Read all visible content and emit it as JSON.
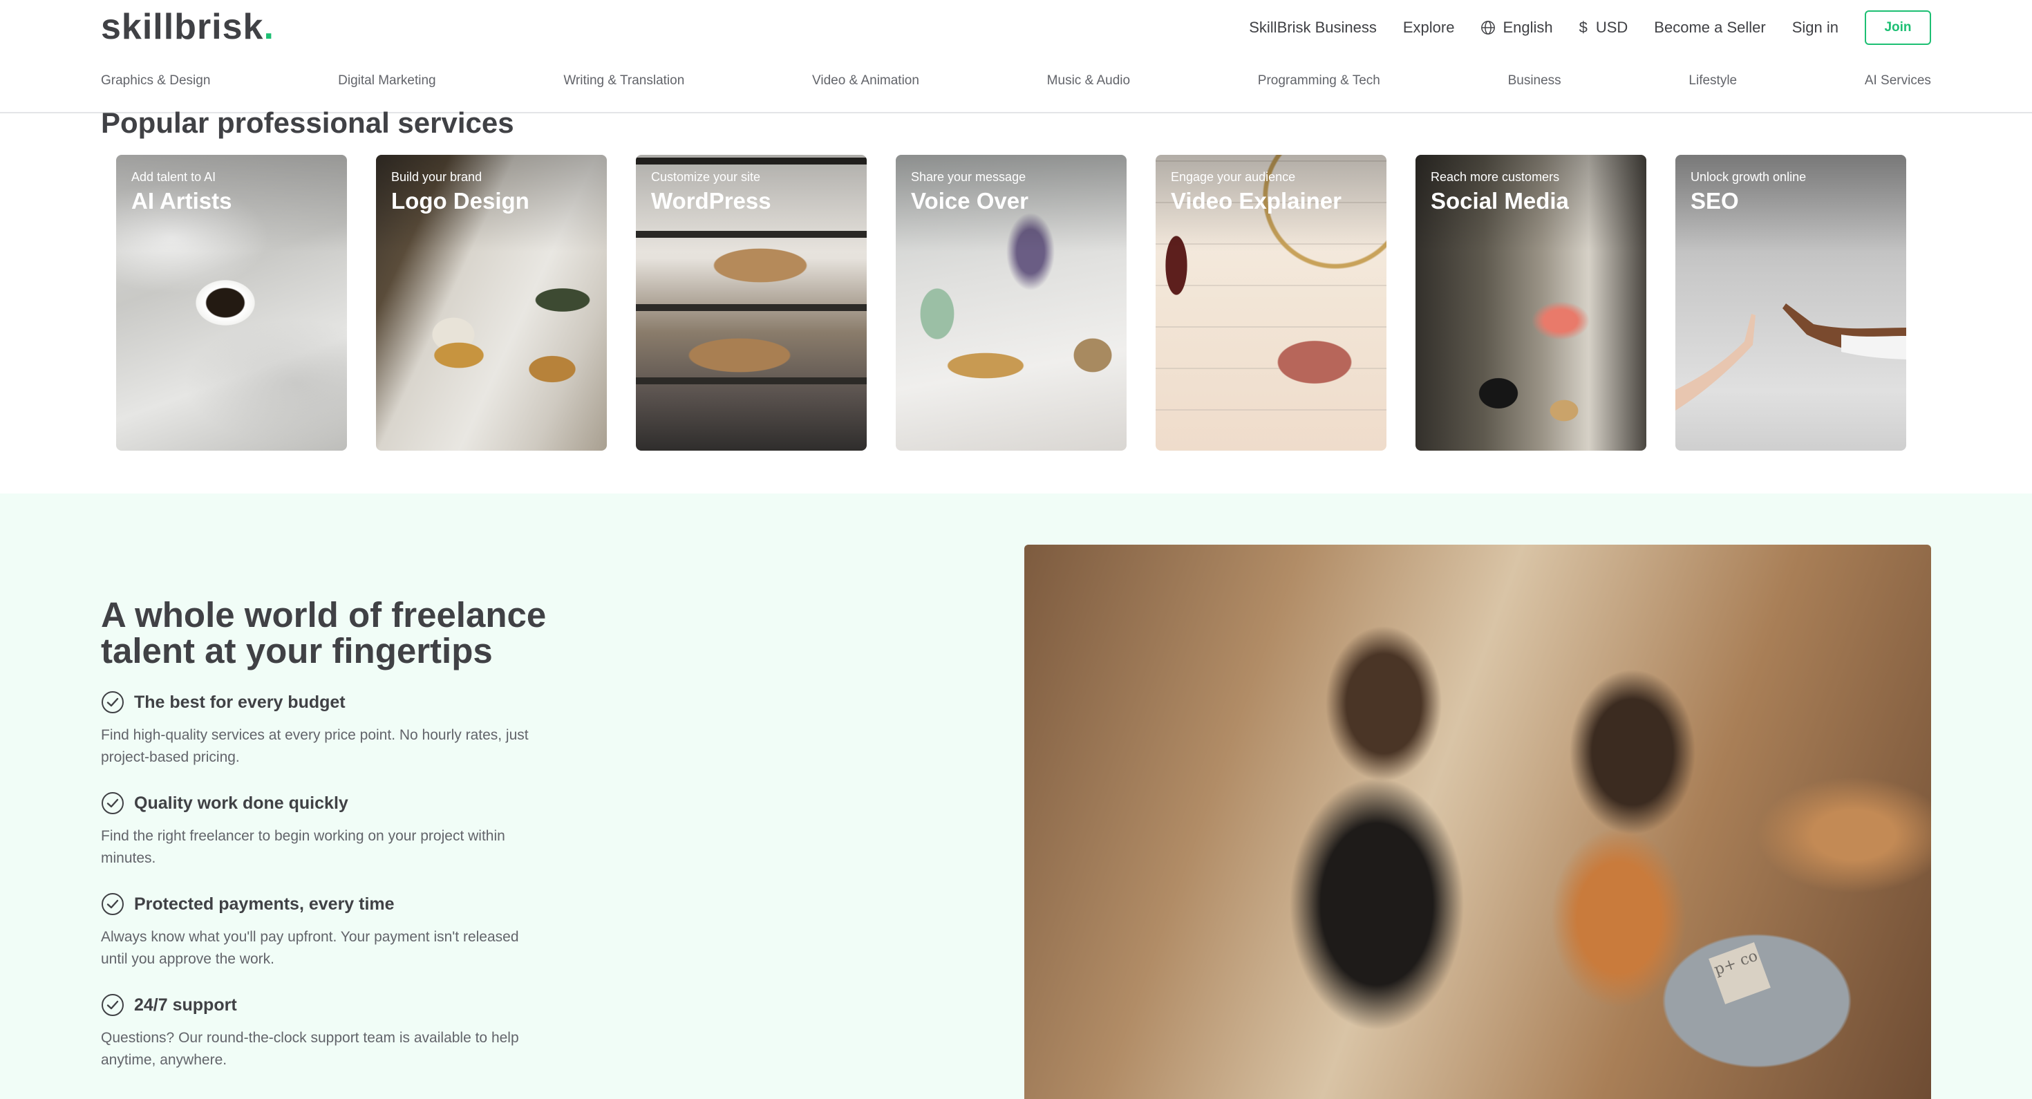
{
  "header": {
    "logo_text": "skillbrisk",
    "logo_dot": ".",
    "top_links": {
      "business": "SkillBrisk Business",
      "explore": "Explore",
      "language": "English",
      "currency_symbol": "$",
      "currency": "USD",
      "become_seller": "Become a Seller",
      "sign_in": "Sign in",
      "join": "Join"
    },
    "categories": [
      "Graphics & Design",
      "Digital Marketing",
      "Writing & Translation",
      "Video & Animation",
      "Music & Audio",
      "Programming & Tech",
      "Business",
      "Lifestyle",
      "AI Services"
    ]
  },
  "popular": {
    "title": "Popular professional services",
    "cards": [
      {
        "subtitle": "Add talent to AI",
        "title": "AI Artists"
      },
      {
        "subtitle": "Build your brand",
        "title": "Logo Design"
      },
      {
        "subtitle": "Customize your site",
        "title": "WordPress"
      },
      {
        "subtitle": "Share your message",
        "title": "Voice Over"
      },
      {
        "subtitle": "Engage your audience",
        "title": "Video Explainer"
      },
      {
        "subtitle": "Reach more customers",
        "title": "Social Media"
      },
      {
        "subtitle": "Unlock growth online",
        "title": "SEO"
      }
    ]
  },
  "benefits": {
    "title": "A whole world of freelance talent at your fingertips",
    "items": [
      {
        "heading": "The best for every budget",
        "text": "Find high-quality services at every price point. No hourly rates, just project-based pricing."
      },
      {
        "heading": "Quality work done quickly",
        "text": "Find the right freelancer to begin working on your project within minutes."
      },
      {
        "heading": "Protected payments, every time",
        "text": "Always know what you'll pay upfront. Your payment isn't released until you approve the work."
      },
      {
        "heading": "24/7 support",
        "text": "Questions? Our round-the-clock support team is available to help anytime, anywhere."
      }
    ],
    "photo_logo_text": "p+ co"
  },
  "colors": {
    "brand_green": "#1dbf73",
    "text_dark": "#404145",
    "text_muted": "#62646a",
    "benefits_bg": "#f1fdf7"
  }
}
